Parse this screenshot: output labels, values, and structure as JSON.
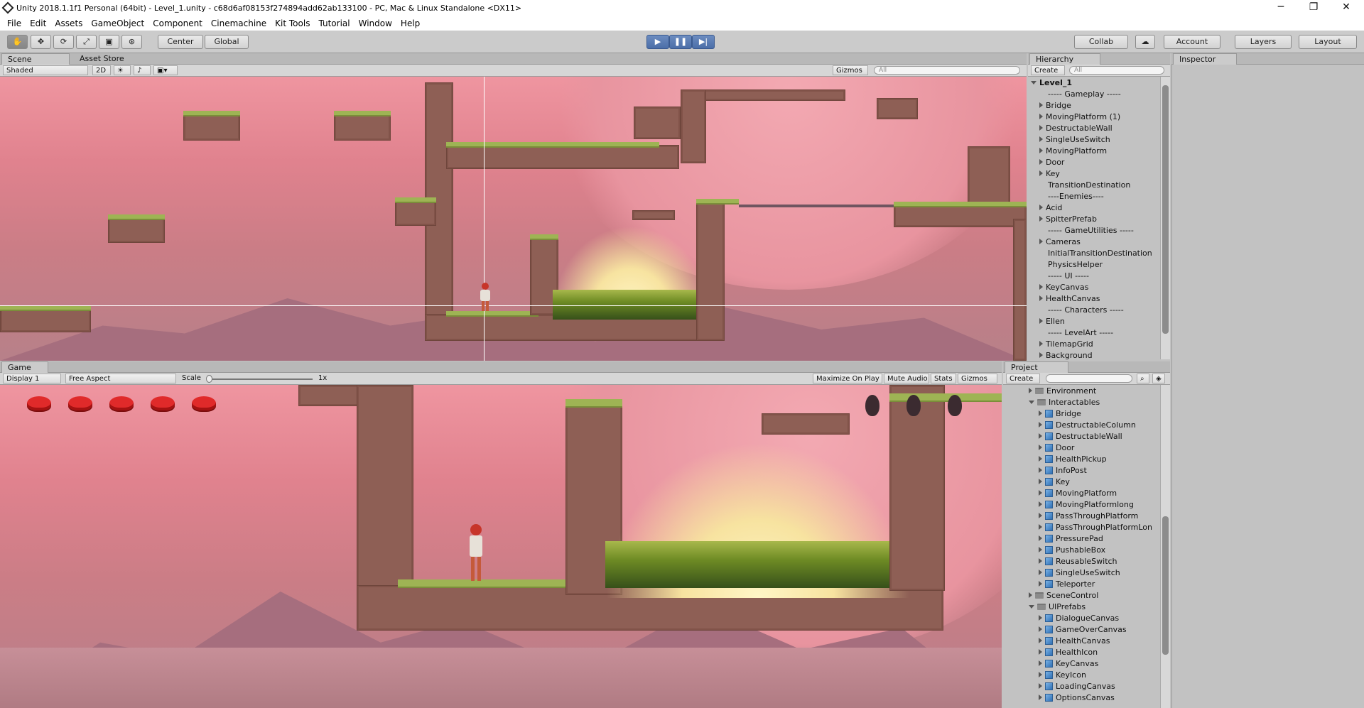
{
  "titlebar": {
    "title": "Unity 2018.1.1f1 Personal (64bit) - Level_1.unity - c68d6af08153f274894add62ab133100 - PC, Mac & Linux Standalone <DX11>",
    "min": "─",
    "max": "❐",
    "close": "✕"
  },
  "menu": [
    "File",
    "Edit",
    "Assets",
    "GameObject",
    "Component",
    "Cinemachine",
    "Kit Tools",
    "Tutorial",
    "Window",
    "Help"
  ],
  "toolbar": {
    "tools": [
      "✋",
      "✥",
      "⟳",
      "⤢",
      "▣",
      "⊛"
    ],
    "pivot": "Center",
    "space": "Global",
    "play": "▶",
    "pause": "❚❚",
    "step": "▶|",
    "collab": "Collab",
    "cloud": "☁",
    "account": "Account",
    "layers": "Layers",
    "layout": "Layout"
  },
  "scene": {
    "tabs": [
      "Scene",
      "Asset Store"
    ],
    "shading": "Shaded",
    "mode2d": "2D",
    "gizmos": "Gizmos",
    "search_placeholder": "All"
  },
  "hierarchy": {
    "tab": "Hierarchy",
    "create": "Create",
    "search_placeholder": "All",
    "root": "Level_1",
    "items": [
      {
        "label": "----- Gameplay -----",
        "arrow": false
      },
      {
        "label": "Bridge",
        "arrow": true
      },
      {
        "label": "MovingPlatform (1)",
        "arrow": true
      },
      {
        "label": "DestructableWall",
        "arrow": true
      },
      {
        "label": "SingleUseSwitch",
        "arrow": true
      },
      {
        "label": "MovingPlatform",
        "arrow": true
      },
      {
        "label": "Door",
        "arrow": true
      },
      {
        "label": "Key",
        "arrow": true
      },
      {
        "label": "TransitionDestination",
        "arrow": false
      },
      {
        "label": "----Enemies----",
        "arrow": false
      },
      {
        "label": "Acid",
        "arrow": true
      },
      {
        "label": "SpitterPrefab",
        "arrow": true
      },
      {
        "label": "----- GameUtilities -----",
        "arrow": false
      },
      {
        "label": "Cameras",
        "arrow": true
      },
      {
        "label": "InitialTransitionDestination",
        "arrow": false
      },
      {
        "label": "PhysicsHelper",
        "arrow": false
      },
      {
        "label": "----- UI -----",
        "arrow": false
      },
      {
        "label": "KeyCanvas",
        "arrow": true
      },
      {
        "label": "HealthCanvas",
        "arrow": true
      },
      {
        "label": "----- Characters -----",
        "arrow": false
      },
      {
        "label": "Ellen",
        "arrow": true
      },
      {
        "label": "----- LevelArt -----",
        "arrow": false
      },
      {
        "label": "TilemapGrid",
        "arrow": true
      },
      {
        "label": "Background",
        "arrow": true
      }
    ]
  },
  "inspector": {
    "tab": "Inspector"
  },
  "game": {
    "tab": "Game",
    "display": "Display 1",
    "aspect": "Free Aspect",
    "scale_label": "Scale",
    "scale_value": "1x",
    "options": [
      "Maximize On Play",
      "Mute Audio",
      "Stats",
      "Gizmos"
    ],
    "health": 5
  },
  "project": {
    "tab": "Project",
    "create": "Create",
    "items": [
      {
        "label": "Environment",
        "type": "folder",
        "level": 0,
        "open": false
      },
      {
        "label": "Interactables",
        "type": "folder",
        "level": 0,
        "open": true
      },
      {
        "label": "Bridge",
        "type": "prefab",
        "level": 1
      },
      {
        "label": "DestructableColumn",
        "type": "prefab",
        "level": 1
      },
      {
        "label": "DestructableWall",
        "type": "prefab",
        "level": 1
      },
      {
        "label": "Door",
        "type": "prefab",
        "level": 1
      },
      {
        "label": "HealthPickup",
        "type": "prefab",
        "level": 1
      },
      {
        "label": "InfoPost",
        "type": "prefab",
        "level": 1
      },
      {
        "label": "Key",
        "type": "prefab",
        "level": 1
      },
      {
        "label": "MovingPlatform",
        "type": "prefab",
        "level": 1
      },
      {
        "label": "MovingPlatformlong",
        "type": "prefab",
        "level": 1
      },
      {
        "label": "PassThroughPlatform",
        "type": "prefab",
        "level": 1
      },
      {
        "label": "PassThroughPlatformLon",
        "type": "prefab",
        "level": 1
      },
      {
        "label": "PressurePad",
        "type": "prefab",
        "level": 1
      },
      {
        "label": "PushableBox",
        "type": "prefab",
        "level": 1
      },
      {
        "label": "ReusableSwitch",
        "type": "prefab",
        "level": 1
      },
      {
        "label": "SingleUseSwitch",
        "type": "prefab",
        "level": 1
      },
      {
        "label": "Teleporter",
        "type": "prefab",
        "level": 1
      },
      {
        "label": "SceneControl",
        "type": "folder",
        "level": 0,
        "open": false
      },
      {
        "label": "UIPrefabs",
        "type": "folder",
        "level": 0,
        "open": true
      },
      {
        "label": "DialogueCanvas",
        "type": "prefab",
        "level": 1
      },
      {
        "label": "GameOverCanvas",
        "type": "prefab",
        "level": 1
      },
      {
        "label": "HealthCanvas",
        "type": "prefab",
        "level": 1
      },
      {
        "label": "HealthIcon",
        "type": "prefab",
        "level": 1
      },
      {
        "label": "KeyCanvas",
        "type": "prefab",
        "level": 1
      },
      {
        "label": "KeyIcon",
        "type": "prefab",
        "level": 1
      },
      {
        "label": "LoadingCanvas",
        "type": "prefab",
        "level": 1
      },
      {
        "label": "OptionsCanvas",
        "type": "prefab",
        "level": 1
      }
    ]
  }
}
